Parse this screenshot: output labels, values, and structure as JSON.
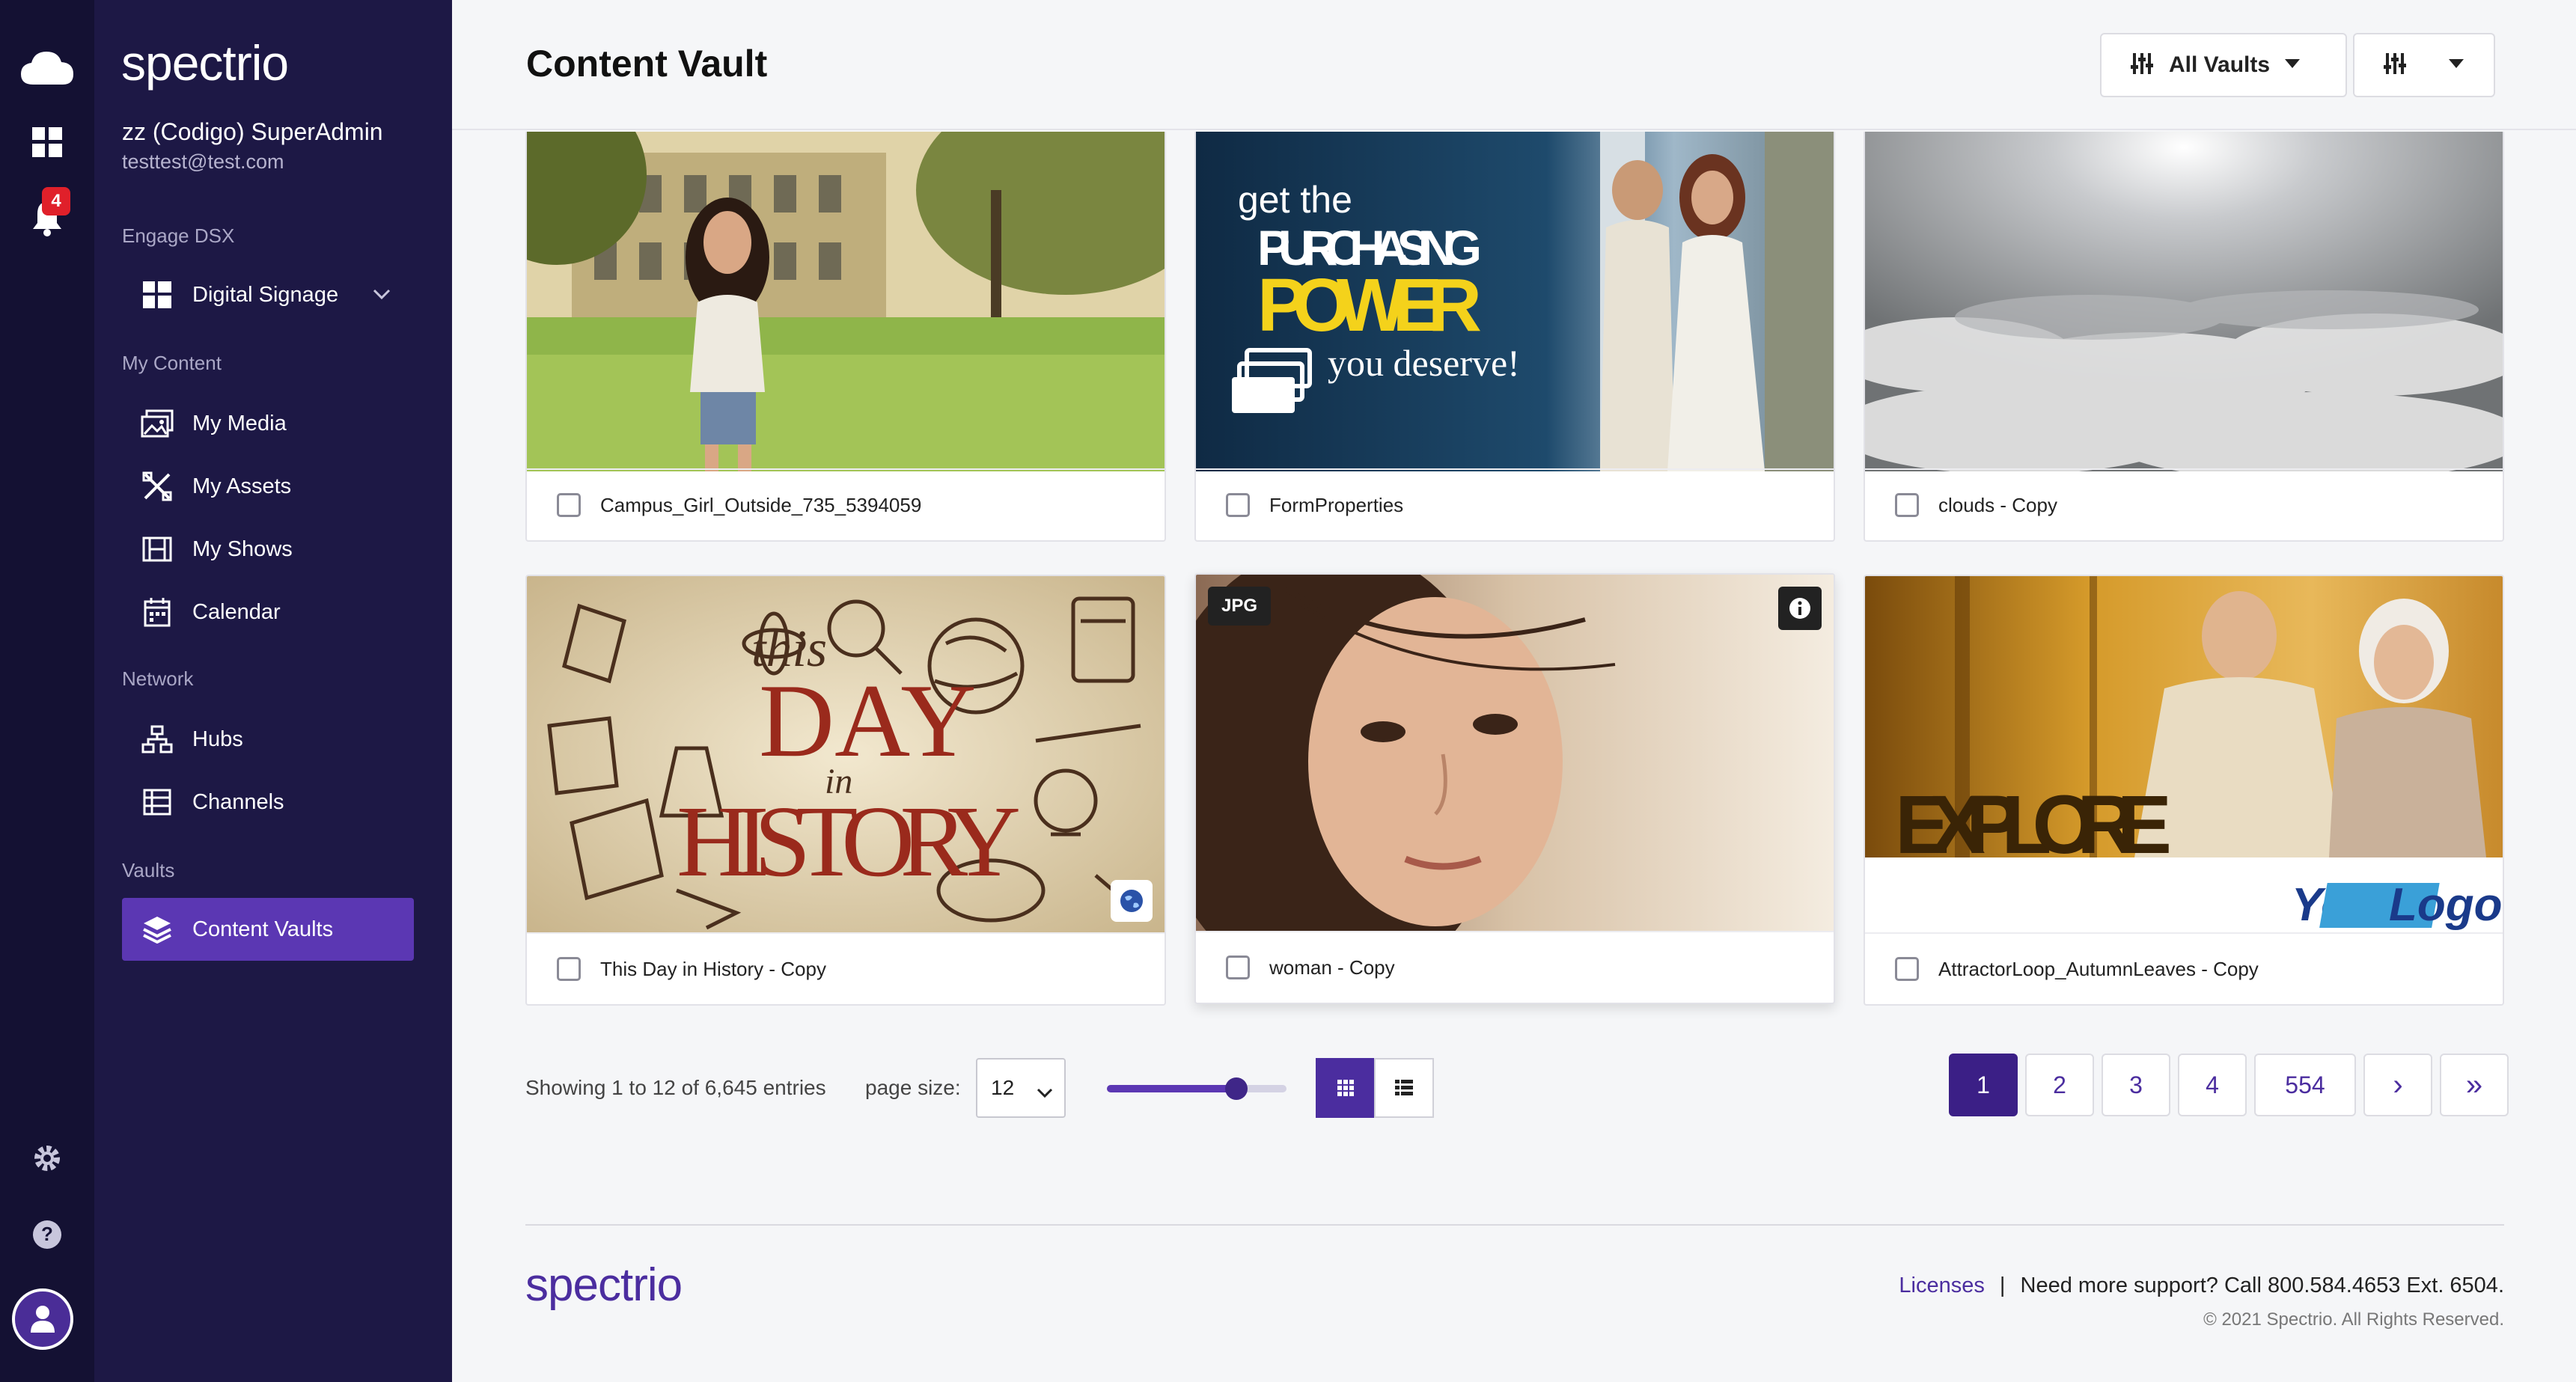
{
  "app": {
    "brand": "spectrio",
    "notification_count": "4"
  },
  "user": {
    "name": "zz (Codigo) SuperAdmin",
    "email": "testtest@test.com"
  },
  "sidebar": {
    "engage_label": "Engage DSX",
    "digital_signage": "Digital Signage",
    "my_content_label": "My Content",
    "content_items": [
      {
        "label": "My Media",
        "icon": "media-icon"
      },
      {
        "label": "My Assets",
        "icon": "assets-icon"
      },
      {
        "label": "My Shows",
        "icon": "film-icon"
      },
      {
        "label": "Calendar",
        "icon": "calendar-icon"
      }
    ],
    "network_label": "Network",
    "network_items": [
      {
        "label": "Hubs",
        "icon": "hubs-icon"
      },
      {
        "label": "Channels",
        "icon": "channels-icon"
      }
    ],
    "vaults_label": "Vaults",
    "vault_items": [
      {
        "label": "Content Vaults",
        "icon": "layers-icon",
        "active": true
      }
    ]
  },
  "header": {
    "title": "Content Vault",
    "vault_filter": "All Vaults"
  },
  "cards": [
    {
      "name": "Campus_Girl_Outside_735_5394059"
    },
    {
      "name": "FormProperties",
      "overlay": {
        "line1": "get the",
        "line2": "PURCHASING",
        "line3": "POWER",
        "line4": "you deserve!"
      }
    },
    {
      "name": "clouds - Copy"
    },
    {
      "name": "This Day in History - Copy",
      "overlay": {
        "line1": "this",
        "line2": "DAY",
        "line3": "in",
        "line4": "HISTORY"
      }
    },
    {
      "name": "woman - Copy",
      "badge": "JPG"
    },
    {
      "name": "AttractorLoop_AutumnLeaves - Copy",
      "overlay": {
        "line1": "EXPLORE",
        "logo_a": "Your",
        "logo_b": "Logo"
      }
    }
  ],
  "table_controls": {
    "showing": "Showing 1 to 12 of 6,645 entries",
    "page_size_label": "page size:",
    "page_size": "12",
    "thumb_size_fraction": 0.72
  },
  "pagination": {
    "pages": [
      "1",
      "2",
      "3",
      "4",
      "554"
    ],
    "current": "1",
    "next": "›",
    "last": "»"
  },
  "footer": {
    "brand": "spectrio",
    "licenses": "Licenses",
    "separator": "|",
    "support": "Need more support? Call 800.584.4653 Ext. 6504.",
    "copyright": "© 2021 Spectrio. All Rights Reserved."
  },
  "colors": {
    "rail": "#141133",
    "sidebar": "#1d1845",
    "accent": "#5b37b3",
    "accent_dark": "#3b1f86",
    "badge_red": "#e0202a"
  }
}
